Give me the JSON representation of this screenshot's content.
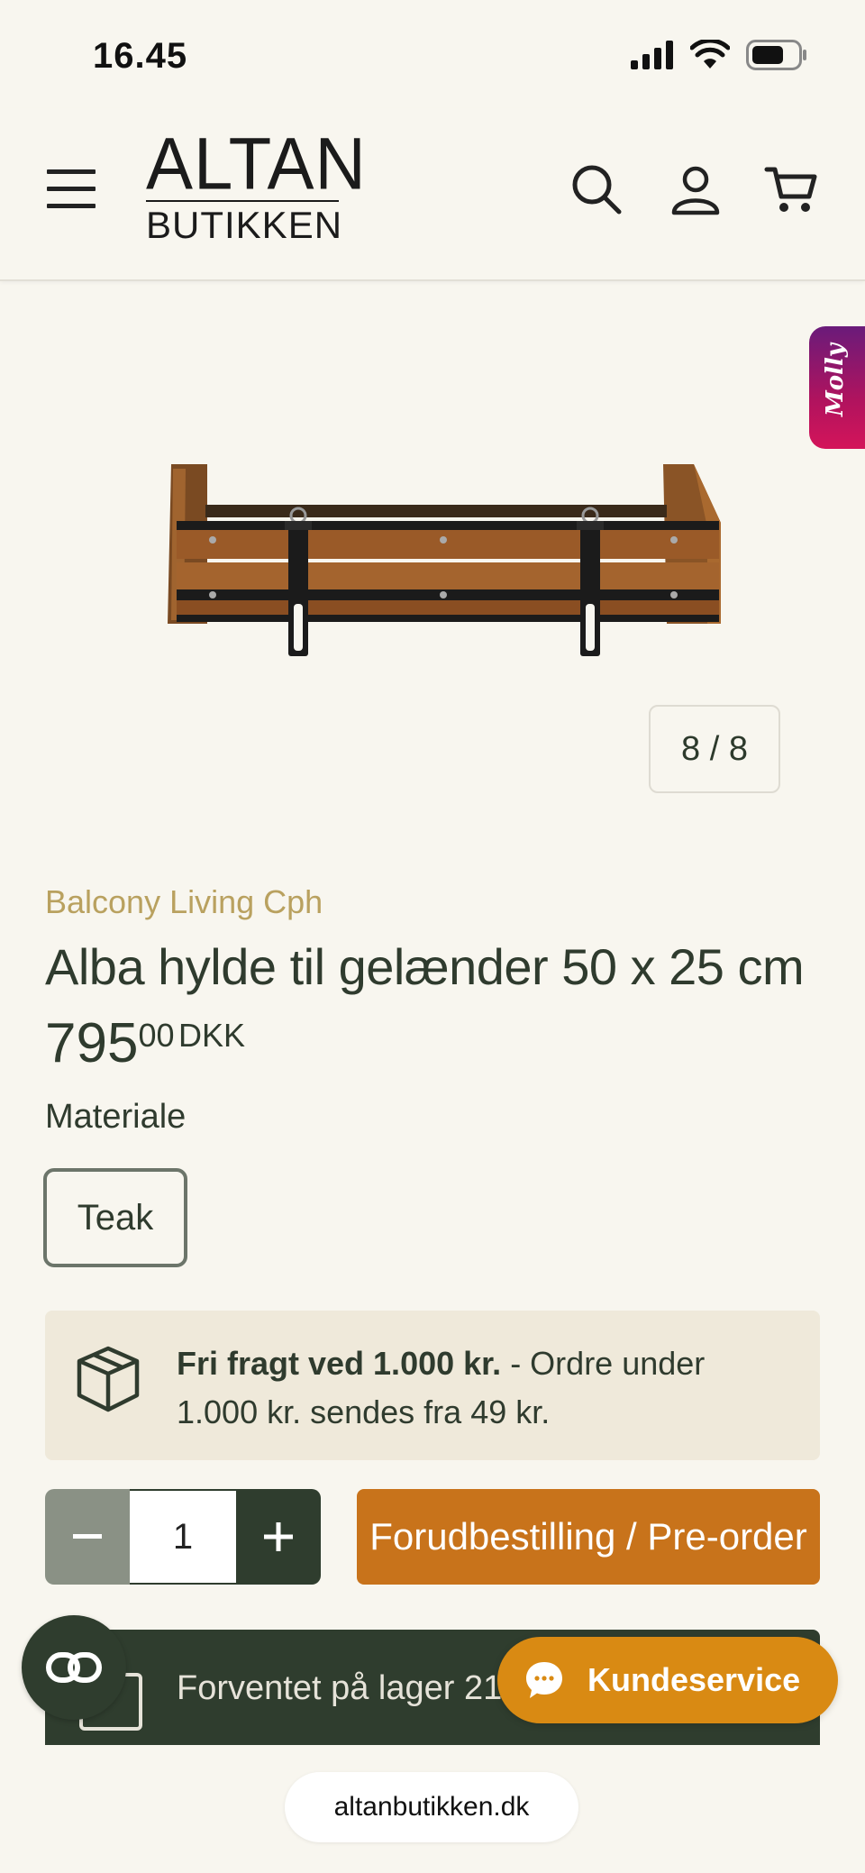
{
  "status_bar": {
    "time": "16.45"
  },
  "header": {
    "logo_top": "ALTAN",
    "logo_bottom": "BUTIKKEN",
    "icons": [
      "menu-icon",
      "search-icon",
      "account-icon",
      "cart-icon"
    ]
  },
  "molly": {
    "label": "Molly"
  },
  "gallery": {
    "counter": "8 / 8"
  },
  "product": {
    "brand": "Balcony Living Cph",
    "title": "Alba hylde til gelænder 50 x 25 cm",
    "price_main": "795",
    "price_cents": "00",
    "price_currency": "DKK",
    "option_label": "Materiale",
    "option_value": "Teak"
  },
  "shipping": {
    "bold": "Fri fragt ved 1.000 kr.",
    "rest": " - Ordre under 1.000 kr. sendes fra 49 kr."
  },
  "cart": {
    "quantity": "1",
    "minus": "−",
    "plus": "+",
    "preorder_label": "Forudbestilling / Pre-order"
  },
  "stock": {
    "text": "Forventet på lager 21.-30. ju"
  },
  "support": {
    "label": "Kundeservice"
  },
  "browser": {
    "url": "altanbutikken.dk"
  },
  "colors": {
    "background": "#f8f6ef",
    "primary_dark": "#2f3d2e",
    "accent_orange": "#c8731b",
    "brand_gold": "#b9a15f"
  }
}
